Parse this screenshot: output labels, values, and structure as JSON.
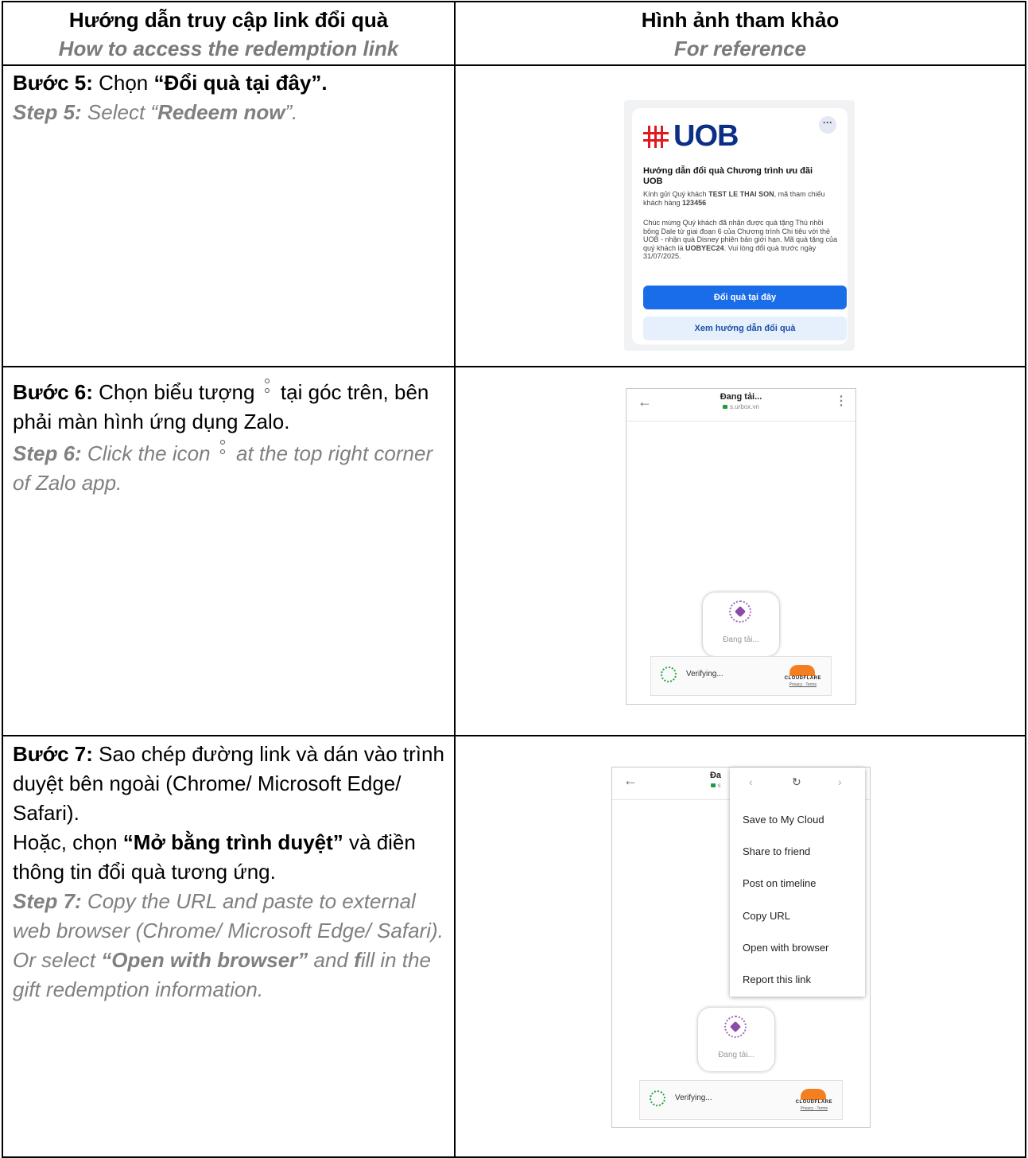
{
  "header": {
    "col1_vi": "Hướng dẫn truy cập link đổi quà",
    "col1_en": "How to access the redemption link",
    "col2_vi": "Hình ảnh tham khảo",
    "col2_en": "For reference"
  },
  "step5": {
    "vi_prefix": "Bước 5:",
    "vi_mid": " Chọn ",
    "vi_bold": "“Đổi quà tại đây”.",
    "en_prefix": "Step 5:",
    "en_mid": " Select “",
    "en_bold": "Redeem now",
    "en_end": "”."
  },
  "step6": {
    "vi_prefix": "Bước 6:",
    "vi_a": " Chọn biểu tượng ",
    "vi_b": " tại góc trên, bên phải màn hình ứng dụng Zalo.",
    "en_prefix": "Step 6:",
    "en_a": " Click the icon ",
    "en_b": " at the top right corner of Zalo app."
  },
  "step7": {
    "vi_prefix": "Bước 7:",
    "vi_a": " Sao chép đường link và dán vào trình duyệt bên ngoài (Chrome/ Microsoft Edge/ Safari).",
    "vi_b": "Hoặc, chọn ",
    "vi_bold": "“Mở bằng trình duyệt”",
    "vi_c": " và điền thông tin đổi quà tương ứng.",
    "en_prefix": "Step 7:",
    "en_a": " Copy the URL and paste to external web browser (Chrome/ Microsoft Edge/ Safari).",
    "en_b": "Or select ",
    "en_bold": "“Open with browser”",
    "en_c": " and ",
    "en_f": "f",
    "en_d": "ill in the gift redemption information."
  },
  "card_uob": {
    "logo": "UOB",
    "title": "Hướng dẫn đổi quà Chương trình ưu đãi UOB",
    "p1_a": "Kính gửi Quý khách ",
    "p1_name": "TEST LE THAI SON",
    "p1_b": ", mã tham chiếu khách hàng ",
    "p1_code": "123456",
    "p2_a": "Chúc mừng Quý khách đã nhận được quà tặng Thú nhồi bông Dale từ giai đoạn 6 của Chương trình Chi tiêu với thẻ UOB - nhận quà Disney phiên bản giới hạn. Mã quà tặng của quý khách là ",
    "p2_code": "UOBYEC24",
    "p2_b": ". Vui lòng đổi quà trước ngày 31/07/2025.",
    "btn_primary": "Đổi quà tại đây",
    "btn_secondary": "Xem hướng dẫn đổi quà",
    "more": "···"
  },
  "screen_loading": {
    "title": "Đang tải...",
    "url": "s.urbox.vn",
    "loader_label": "Đang tải...",
    "verify": "Verifying...",
    "cf_name": "CLOUDFLARE",
    "cf_links": "Privacy · Terms",
    "menu_icon": "⋮",
    "back_icon": "←"
  },
  "screen_menu": {
    "title": "Đa",
    "url": "s",
    "items": [
      "Save to My Cloud",
      "Share to friend",
      "Post on timeline",
      "Copy URL",
      "Open with browser",
      "Report this link"
    ],
    "loader_label": "Đang tải...",
    "verify": "Verifying...",
    "cf_name": "CLOUDFLARE",
    "cf_links": "Privacy · Terms",
    "back_icon": "←",
    "nav_back": "‹",
    "nav_reload": "↻",
    "nav_forward": "›"
  },
  "colors": {
    "uob_red": "#e0191f",
    "uob_blue": "#0b2f86",
    "primary_button": "#1a6de8",
    "cloudflare_orange": "#f38020",
    "english_text": "#808080"
  }
}
